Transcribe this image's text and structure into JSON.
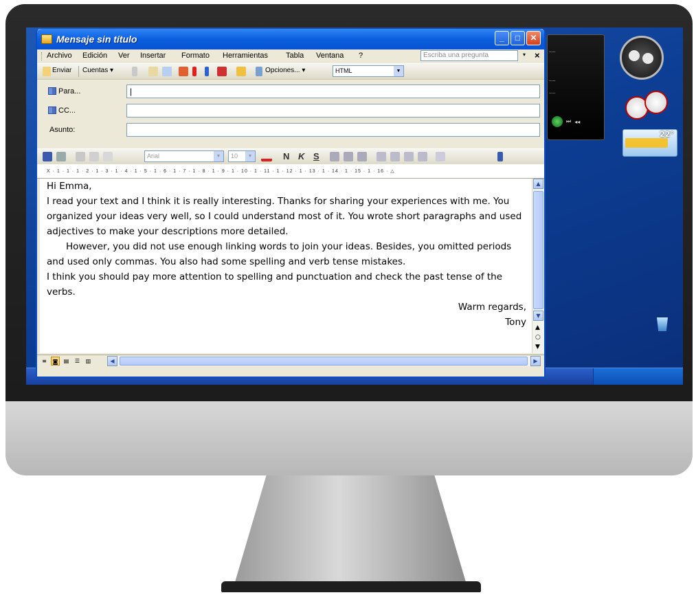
{
  "window": {
    "title": "Mensaje sin título",
    "minimize_glyph": "_",
    "maximize_glyph": "□",
    "close_glyph": "✕"
  },
  "menu": {
    "items": [
      "Archivo",
      "Edición",
      "Ver",
      "Insertar",
      "Formato",
      "Herramientas",
      "Tabla",
      "Ventana",
      "?"
    ],
    "help_placeholder": "Escriba una pregunta",
    "help_arrow": "▾",
    "close_doc": "×"
  },
  "toolbar": {
    "send_label": "Enviar",
    "accounts_label": "Cuentas ▾",
    "options_label": "Opciones... ▾",
    "format_value": "HTML"
  },
  "fields": {
    "to_label": "Para...",
    "cc_label": "CC...",
    "subject_label": "Asunto:",
    "to_value": "|",
    "cc_value": "",
    "subject_value": ""
  },
  "format_bar": {
    "font_value": "Arial",
    "size_value": "10",
    "bold": "N",
    "italic": "K",
    "underline": "S"
  },
  "ruler": {
    "marks": "X · 1 · 1 · 1 · 2 · 1 · 3 · 1 · 4 · 1 · 5 · 1 · 6 · 1 · 7 · 1 · 8 · 1 · 9 · 1 · 10 · 1 · 11 · 1 · 12 · 1 · 13 · 1 · 14 · 1 · 15 · 1 · 16 · △"
  },
  "message": {
    "greeting": "Hi Emma,",
    "p1": "I read your text and I think it is really interesting. Thanks for sharing your experiences with me. You organized your ideas very well, so I could understand most of it. You wrote short paragraphs and used adjectives to make your descriptions more detailed.",
    "p2": "However, you did not use enough linking words to join your ideas. Besides, you omitted periods and used only commas. You also had some spelling and verb tense mistakes.",
    "p3": "I think you should pay more attention to spelling and punctuation and check the past tense of the verbs.",
    "closing": "Warm regards,",
    "signature": "Tony"
  },
  "desktop": {
    "weather_temp": "22°"
  },
  "colors": {
    "titlebar": "#0b5fe0",
    "desktop": "#0d3f96",
    "window_face": "#ece9d8"
  }
}
